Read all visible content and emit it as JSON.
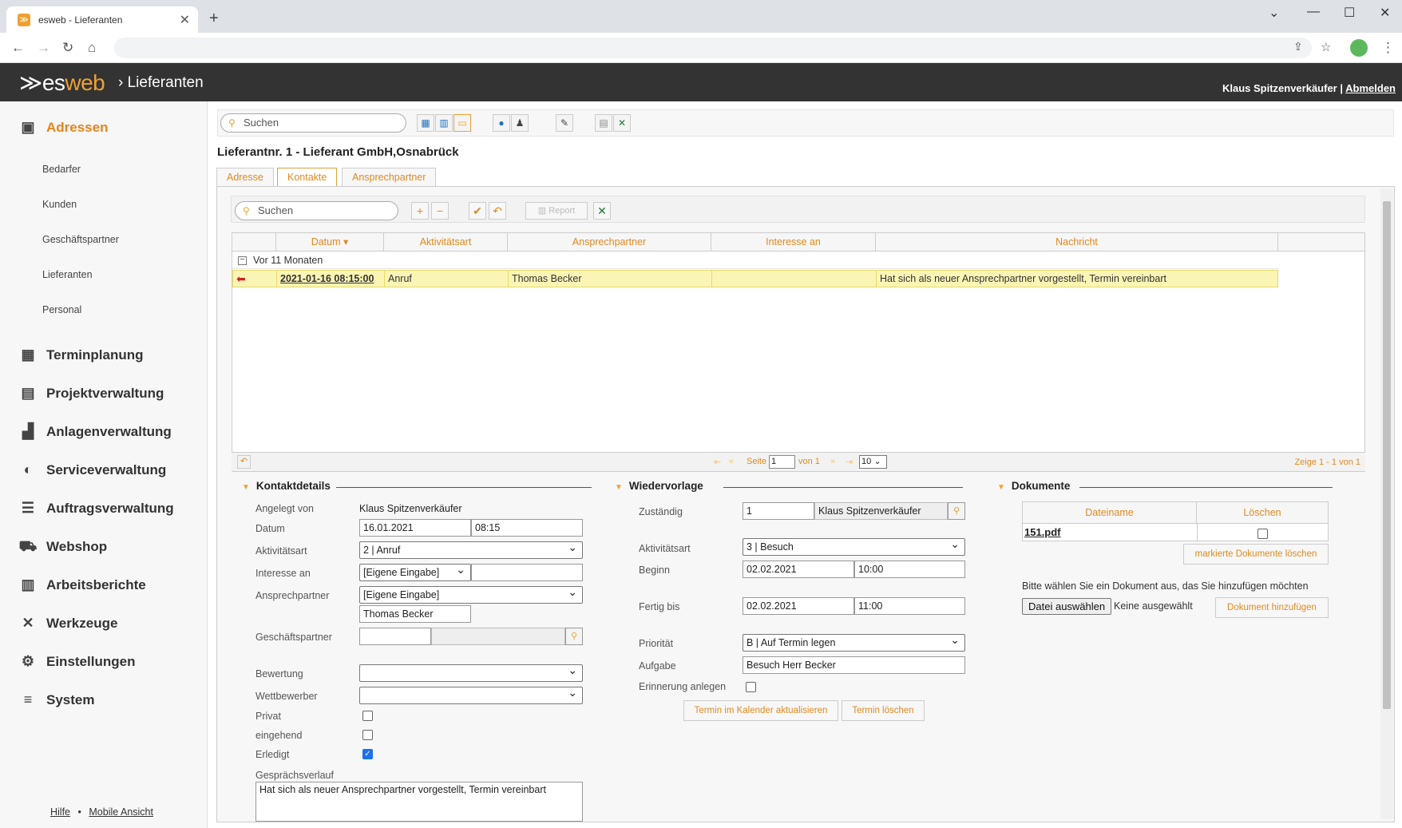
{
  "browser": {
    "tab_title": "esweb - Lieferanten",
    "favicon_glyph": "≫",
    "new_tab": "+",
    "close_tab": "✕"
  },
  "app": {
    "logo_prefix": "≫es",
    "logo_suffix": "web",
    "section_sep": "›",
    "section": "Lieferanten",
    "user": "Klaus Spitzenverkäufer",
    "separator": "|",
    "logout": "Abmelden"
  },
  "sidebar": {
    "main_items": [
      {
        "label": "Adressen",
        "icon": "contacts-icon",
        "active": true
      },
      {
        "label": "Terminplanung",
        "icon": "calendar-icon"
      },
      {
        "label": "Projektverwaltung",
        "icon": "gantt-icon"
      },
      {
        "label": "Anlagenverwaltung",
        "icon": "factory-icon"
      },
      {
        "label": "Serviceverwaltung",
        "icon": "headset-icon"
      },
      {
        "label": "Auftragsverwaltung",
        "icon": "list-icon"
      },
      {
        "label": "Webshop",
        "icon": "cart-icon"
      },
      {
        "label": "Arbeitsberichte",
        "icon": "clipboard-icon"
      },
      {
        "label": "Werkzeuge",
        "icon": "tools-icon"
      },
      {
        "label": "Einstellungen",
        "icon": "gears-icon"
      },
      {
        "label": "System",
        "icon": "database-icon"
      }
    ],
    "sub_items": [
      "Bedarfer",
      "Kunden",
      "Geschäftspartner",
      "Lieferanten",
      "Personal"
    ],
    "footer": {
      "help": "Hilfe",
      "dot": "•",
      "mobile": "Mobile Ansicht"
    }
  },
  "toolbar": {
    "search_placeholder": "Suchen"
  },
  "page": {
    "title": "Lieferantnr. 1 - Lieferant GmbH,Osnabrück"
  },
  "tabs": [
    "Adresse",
    "Kontakte",
    "Ansprechpartner"
  ],
  "grid": {
    "search_placeholder": "Suchen",
    "report_label": "Report",
    "columns": [
      "Datum",
      "Aktivitätsart",
      "Ansprechpartner",
      "Interesse an",
      "Nachricht"
    ],
    "group_label": "Vor 11 Monaten",
    "rows": [
      {
        "datum": "2021-01-16 08:15:00",
        "aktivitaetsart": "Anruf",
        "ansprechpartner": "Thomas Becker",
        "interesse": "",
        "nachricht": "Hat sich als neuer Ansprechpartner vorgestellt, Termin vereinbart"
      }
    ],
    "pager": {
      "page_label": "Seite",
      "page_value": "1",
      "of_label": "von 1",
      "page_size": "10",
      "summary": "Zeige 1 - 1 von 1"
    }
  },
  "kontakt": {
    "title": "Kontaktdetails",
    "angelegt_label": "Angelegt von",
    "angelegt_value": "Klaus Spitzenverkäufer",
    "datum_label": "Datum",
    "datum_value": "16.01.2021",
    "zeit_value": "08:15",
    "aktivitaet_label": "Aktivitätsart",
    "aktivitaet_value": "2 | Anruf",
    "interesse_label": "Interesse an",
    "interesse_value": "[Eigene Eingabe]",
    "interesse_text": "",
    "ansprech_label": "Ansprechpartner",
    "ansprech_value": "[Eigene Eingabe]",
    "ansprech_text": "Thomas Becker",
    "gp_label": "Geschäftspartner",
    "bewertung_label": "Bewertung",
    "wettbewerber_label": "Wettbewerber",
    "privat_label": "Privat",
    "eingehend_label": "eingehend",
    "erledigt_label": "Erledigt",
    "verlauf_label": "Gesprächsverlauf",
    "verlauf_value": "Hat sich als neuer Ansprechpartner vorgestellt, Termin vereinbart"
  },
  "wiedervorlage": {
    "title": "Wiedervorlage",
    "zustaendig_label": "Zuständig",
    "zustaendig_id": "1",
    "zustaendig_name": "Klaus Spitzenverkäufer",
    "aktivitaet_label": "Aktivitätsart",
    "aktivitaet_value": "3 | Besuch",
    "beginn_label": "Beginn",
    "beginn_datum": "02.02.2021",
    "beginn_zeit": "10:00",
    "fertig_label": "Fertig bis",
    "fertig_datum": "02.02.2021",
    "fertig_zeit": "11:00",
    "prioritaet_label": "Priorität",
    "prioritaet_value": "B | Auf Termin legen",
    "aufgabe_label": "Aufgabe",
    "aufgabe_value": "Besuch Herr Becker",
    "erinnerung_label": "Erinnerung anlegen",
    "btn_update": "Termin im Kalender aktualisieren",
    "btn_delete": "Termin löschen"
  },
  "dokumente": {
    "title": "Dokumente",
    "col_name": "Dateiname",
    "col_delete": "Löschen",
    "file": "151.pdf",
    "btn_delete_marked": "markierte Dokumente löschen",
    "hint": "Bitte wählen Sie ein Dokument aus, das Sie hinzufügen möchten",
    "btn_choose": "Datei auswählen",
    "no_file": "Keine ausgewählt",
    "btn_add": "Dokument hinzufügen"
  }
}
